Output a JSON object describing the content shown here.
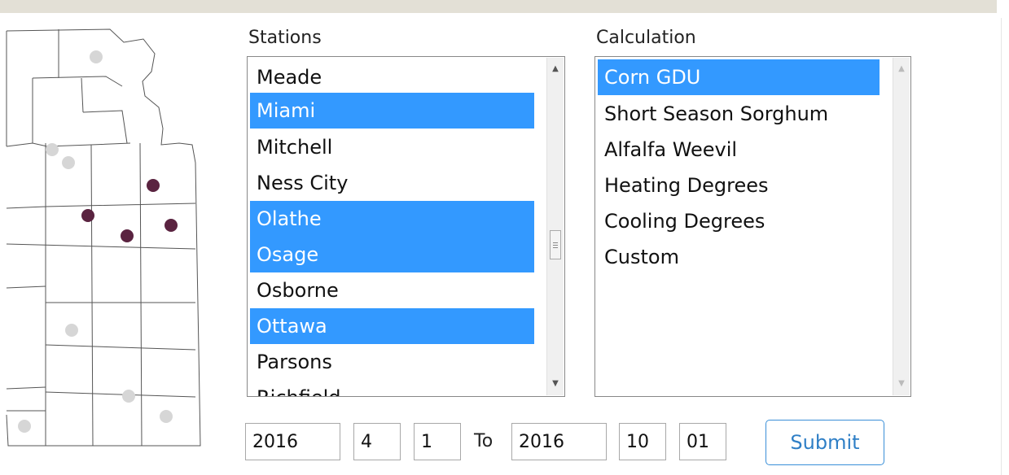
{
  "colors": {
    "selected": "#3399ff",
    "active_station_dot": "#5a2340",
    "inactive_station_dot": "#d6d6d6",
    "submit_border": "#3a8fd8"
  },
  "stations": {
    "label": "Stations",
    "options": [
      {
        "label": "Meade",
        "selected": false
      },
      {
        "label": "Miami",
        "selected": true
      },
      {
        "label": "Mitchell",
        "selected": false
      },
      {
        "label": "Ness City",
        "selected": false
      },
      {
        "label": "Olathe",
        "selected": true
      },
      {
        "label": "Osage",
        "selected": true
      },
      {
        "label": "Osborne",
        "selected": false
      },
      {
        "label": "Ottawa",
        "selected": true
      },
      {
        "label": "Parsons",
        "selected": false
      },
      {
        "label": "Richfield",
        "selected": false
      }
    ]
  },
  "calculation": {
    "label": "Calculation",
    "options": [
      {
        "label": "Corn GDU",
        "selected": true
      },
      {
        "label": "Short Season Sorghum",
        "selected": false
      },
      {
        "label": "Alfalfa Weevil",
        "selected": false
      },
      {
        "label": "Heating Degrees",
        "selected": false
      },
      {
        "label": "Cooling Degrees",
        "selected": false
      },
      {
        "label": "Custom",
        "selected": false
      }
    ]
  },
  "date_range": {
    "start_year": "2016",
    "start_month": "4",
    "start_day": "1",
    "to_label": "To",
    "end_year": "2016",
    "end_month": "10",
    "end_day": "01"
  },
  "submit_label": "Submit"
}
